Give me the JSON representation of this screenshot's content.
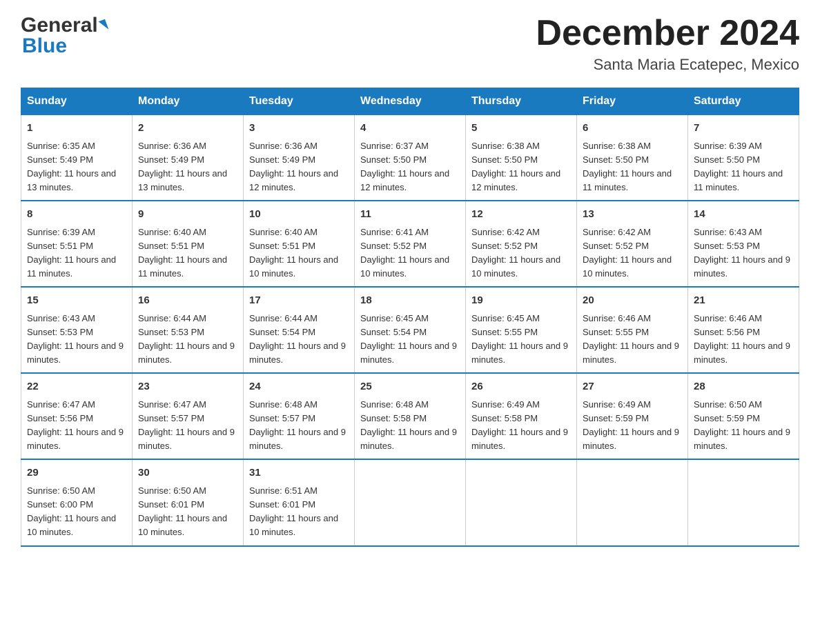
{
  "logo": {
    "general": "General",
    "blue": "Blue"
  },
  "title": "December 2024",
  "location": "Santa Maria Ecatepec, Mexico",
  "weekdays": [
    "Sunday",
    "Monday",
    "Tuesday",
    "Wednesday",
    "Thursday",
    "Friday",
    "Saturday"
  ],
  "weeks": [
    [
      {
        "day": "1",
        "sunrise": "6:35 AM",
        "sunset": "5:49 PM",
        "daylight": "11 hours and 13 minutes."
      },
      {
        "day": "2",
        "sunrise": "6:36 AM",
        "sunset": "5:49 PM",
        "daylight": "11 hours and 13 minutes."
      },
      {
        "day": "3",
        "sunrise": "6:36 AM",
        "sunset": "5:49 PM",
        "daylight": "11 hours and 12 minutes."
      },
      {
        "day": "4",
        "sunrise": "6:37 AM",
        "sunset": "5:50 PM",
        "daylight": "11 hours and 12 minutes."
      },
      {
        "day": "5",
        "sunrise": "6:38 AM",
        "sunset": "5:50 PM",
        "daylight": "11 hours and 12 minutes."
      },
      {
        "day": "6",
        "sunrise": "6:38 AM",
        "sunset": "5:50 PM",
        "daylight": "11 hours and 11 minutes."
      },
      {
        "day": "7",
        "sunrise": "6:39 AM",
        "sunset": "5:50 PM",
        "daylight": "11 hours and 11 minutes."
      }
    ],
    [
      {
        "day": "8",
        "sunrise": "6:39 AM",
        "sunset": "5:51 PM",
        "daylight": "11 hours and 11 minutes."
      },
      {
        "day": "9",
        "sunrise": "6:40 AM",
        "sunset": "5:51 PM",
        "daylight": "11 hours and 11 minutes."
      },
      {
        "day": "10",
        "sunrise": "6:40 AM",
        "sunset": "5:51 PM",
        "daylight": "11 hours and 10 minutes."
      },
      {
        "day": "11",
        "sunrise": "6:41 AM",
        "sunset": "5:52 PM",
        "daylight": "11 hours and 10 minutes."
      },
      {
        "day": "12",
        "sunrise": "6:42 AM",
        "sunset": "5:52 PM",
        "daylight": "11 hours and 10 minutes."
      },
      {
        "day": "13",
        "sunrise": "6:42 AM",
        "sunset": "5:52 PM",
        "daylight": "11 hours and 10 minutes."
      },
      {
        "day": "14",
        "sunrise": "6:43 AM",
        "sunset": "5:53 PM",
        "daylight": "11 hours and 9 minutes."
      }
    ],
    [
      {
        "day": "15",
        "sunrise": "6:43 AM",
        "sunset": "5:53 PM",
        "daylight": "11 hours and 9 minutes."
      },
      {
        "day": "16",
        "sunrise": "6:44 AM",
        "sunset": "5:53 PM",
        "daylight": "11 hours and 9 minutes."
      },
      {
        "day": "17",
        "sunrise": "6:44 AM",
        "sunset": "5:54 PM",
        "daylight": "11 hours and 9 minutes."
      },
      {
        "day": "18",
        "sunrise": "6:45 AM",
        "sunset": "5:54 PM",
        "daylight": "11 hours and 9 minutes."
      },
      {
        "day": "19",
        "sunrise": "6:45 AM",
        "sunset": "5:55 PM",
        "daylight": "11 hours and 9 minutes."
      },
      {
        "day": "20",
        "sunrise": "6:46 AM",
        "sunset": "5:55 PM",
        "daylight": "11 hours and 9 minutes."
      },
      {
        "day": "21",
        "sunrise": "6:46 AM",
        "sunset": "5:56 PM",
        "daylight": "11 hours and 9 minutes."
      }
    ],
    [
      {
        "day": "22",
        "sunrise": "6:47 AM",
        "sunset": "5:56 PM",
        "daylight": "11 hours and 9 minutes."
      },
      {
        "day": "23",
        "sunrise": "6:47 AM",
        "sunset": "5:57 PM",
        "daylight": "11 hours and 9 minutes."
      },
      {
        "day": "24",
        "sunrise": "6:48 AM",
        "sunset": "5:57 PM",
        "daylight": "11 hours and 9 minutes."
      },
      {
        "day": "25",
        "sunrise": "6:48 AM",
        "sunset": "5:58 PM",
        "daylight": "11 hours and 9 minutes."
      },
      {
        "day": "26",
        "sunrise": "6:49 AM",
        "sunset": "5:58 PM",
        "daylight": "11 hours and 9 minutes."
      },
      {
        "day": "27",
        "sunrise": "6:49 AM",
        "sunset": "5:59 PM",
        "daylight": "11 hours and 9 minutes."
      },
      {
        "day": "28",
        "sunrise": "6:50 AM",
        "sunset": "5:59 PM",
        "daylight": "11 hours and 9 minutes."
      }
    ],
    [
      {
        "day": "29",
        "sunrise": "6:50 AM",
        "sunset": "6:00 PM",
        "daylight": "11 hours and 10 minutes."
      },
      {
        "day": "30",
        "sunrise": "6:50 AM",
        "sunset": "6:01 PM",
        "daylight": "11 hours and 10 minutes."
      },
      {
        "day": "31",
        "sunrise": "6:51 AM",
        "sunset": "6:01 PM",
        "daylight": "11 hours and 10 minutes."
      },
      null,
      null,
      null,
      null
    ]
  ],
  "labels": {
    "sunrise": "Sunrise:",
    "sunset": "Sunset:",
    "daylight": "Daylight:"
  }
}
